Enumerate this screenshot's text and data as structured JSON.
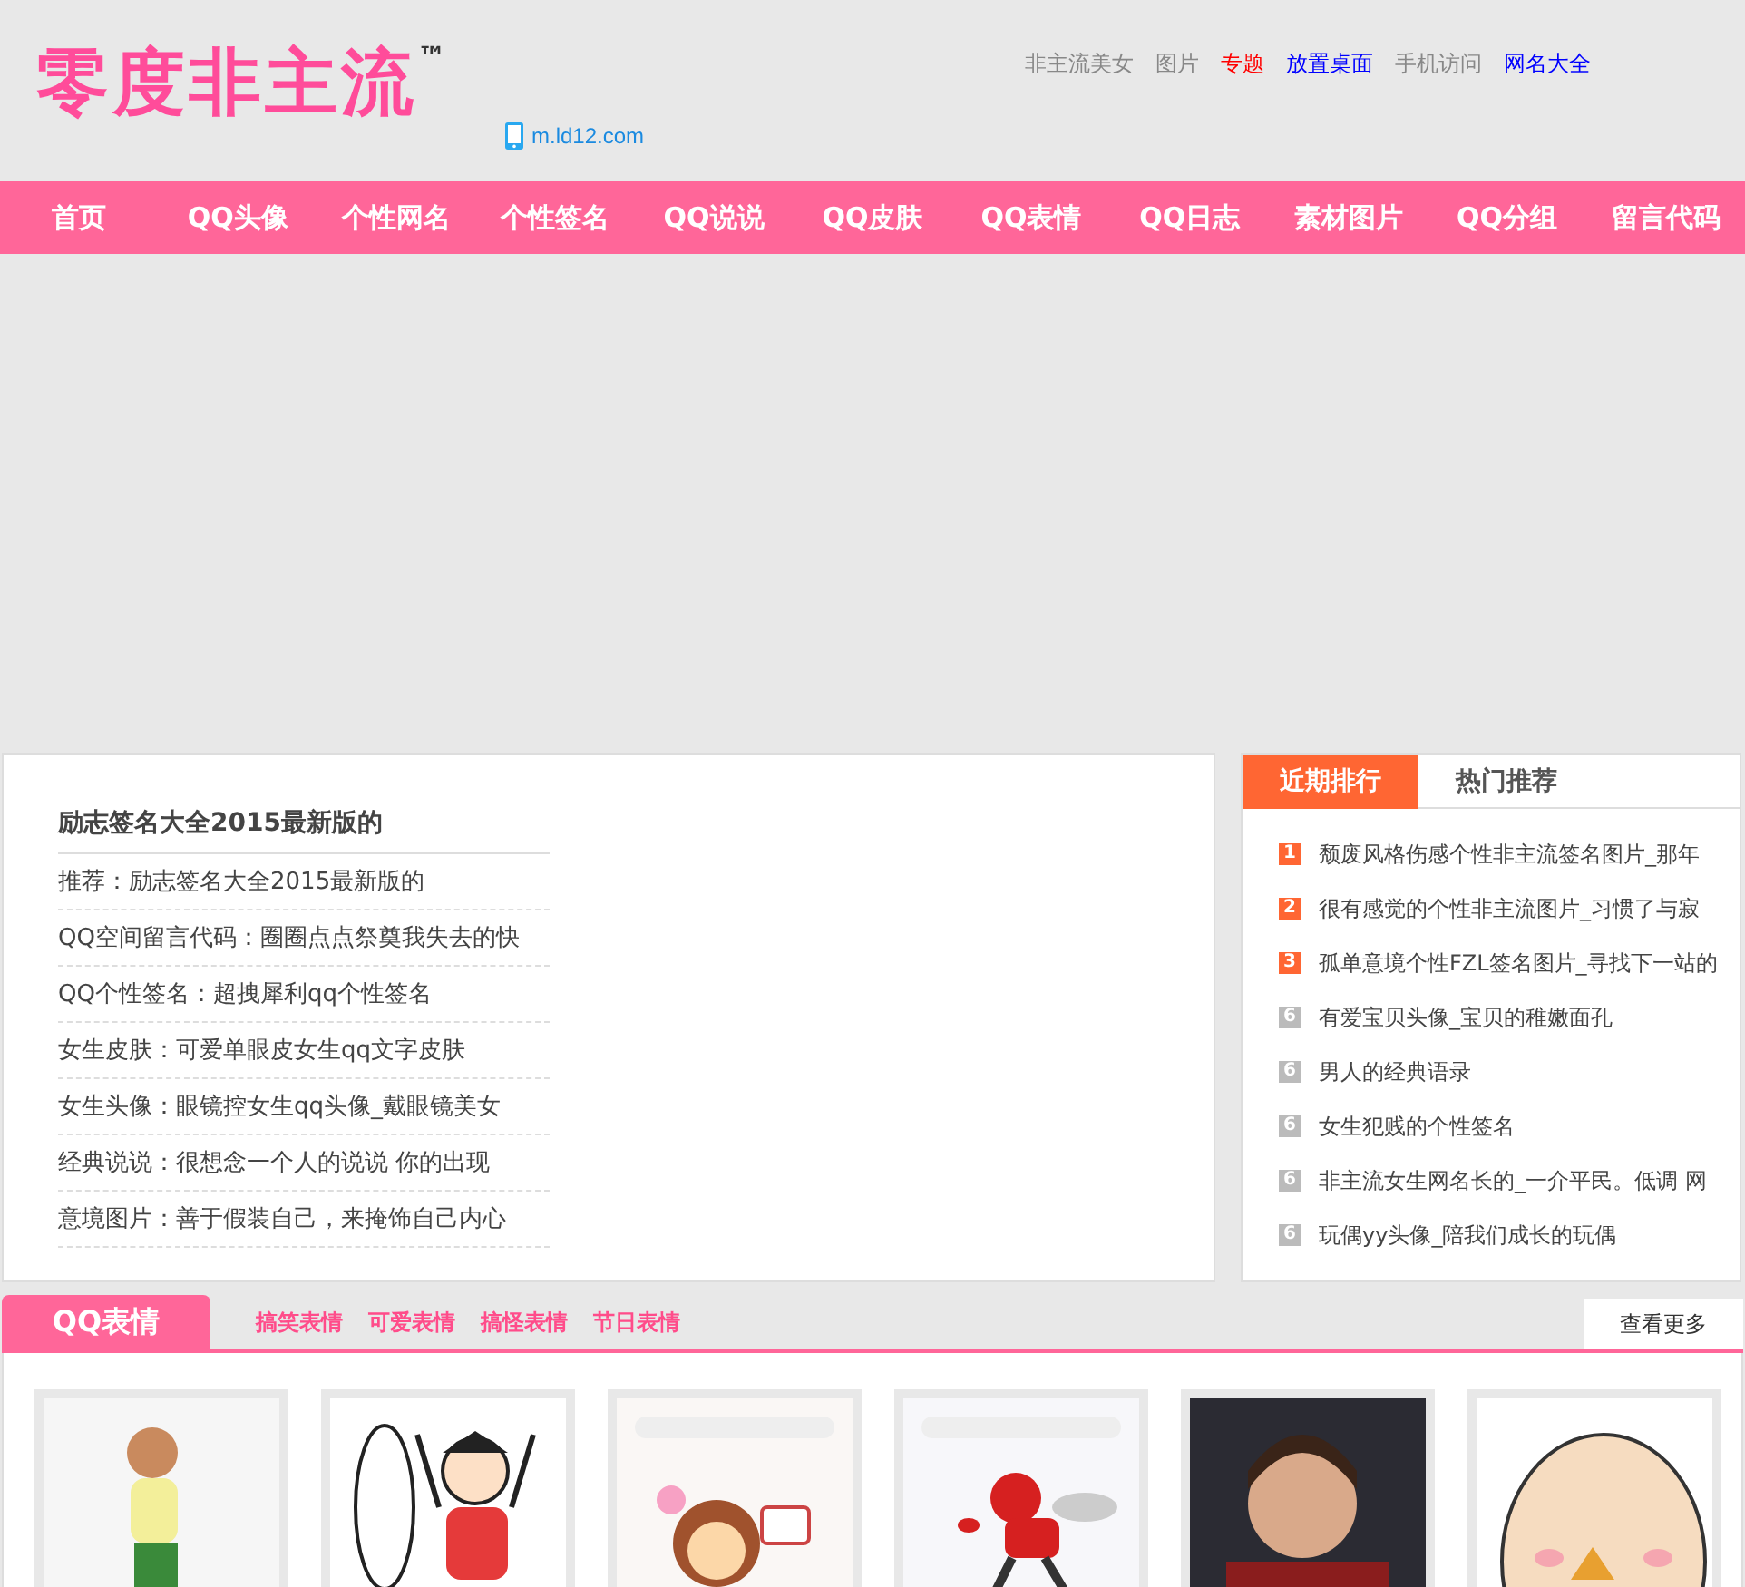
{
  "header": {
    "logo": "零度非主流",
    "trademark": "™",
    "mobile_link": "m.ld12.com",
    "top_links": [
      {
        "label": "非主流美女",
        "color": "#888888"
      },
      {
        "label": "图片",
        "color": "#888888"
      },
      {
        "label": "专题",
        "color": "#ff0000"
      },
      {
        "label": "放置桌面",
        "color": "#0000ff"
      },
      {
        "label": "手机访问",
        "color": "#888888"
      },
      {
        "label": "网名大全",
        "color": "#0000ff"
      }
    ]
  },
  "nav": [
    "首页",
    "QQ头像",
    "个性网名",
    "个性签名",
    "QQ说说",
    "QQ皮肤",
    "QQ表情",
    "QQ日志",
    "素材图片",
    "QQ分组",
    "留言代码"
  ],
  "featured": {
    "title": "励志签名大全2015最新版的",
    "items": [
      "推荐：励志签名大全2015最新版的",
      "QQ空间留言代码：圈圈点点祭奠我失去的快",
      "QQ个性签名：超拽犀利qq个性签名",
      "女生皮肤：可爱单眼皮女生qq文字皮肤",
      "女生头像：眼镜控女生qq头像_戴眼镜美女",
      "经典说说：很想念一个人的说说 你的出现",
      "意境图片：善于假装自己，来掩饰自己内心"
    ]
  },
  "ranking": {
    "tabs": [
      {
        "label": "近期排行",
        "selected": true
      },
      {
        "label": "热门推荐",
        "selected": false
      }
    ],
    "items": [
      {
        "rank": "1",
        "color": "#ff6633",
        "title": "颓废风格伤感个性非主流签名图片_那年"
      },
      {
        "rank": "2",
        "color": "#ff6633",
        "title": "很有感觉的个性非主流图片_习惯了与寂"
      },
      {
        "rank": "3",
        "color": "#ff6633",
        "title": "孤单意境个性FZL签名图片_寻找下一站的"
      },
      {
        "rank": "6",
        "color": "#bbbbbb",
        "title": "有爱宝贝头像_宝贝的稚嫩面孔"
      },
      {
        "rank": "6",
        "color": "#bbbbbb",
        "title": "男人的经典语录"
      },
      {
        "rank": "6",
        "color": "#bbbbbb",
        "title": "女生犯贱的个性签名"
      },
      {
        "rank": "6",
        "color": "#bbbbbb",
        "title": "非主流女生网名长的_一介平民。低调 网"
      },
      {
        "rank": "6",
        "color": "#bbbbbb",
        "title": "玩偶yy头像_陪我们成长的玩偶"
      }
    ]
  },
  "emoji_section": {
    "title": "QQ表情",
    "subtabs": [
      "搞笑表情",
      "可爱表情",
      "搞怪表情",
      "节日表情"
    ],
    "more": "查看更多"
  }
}
